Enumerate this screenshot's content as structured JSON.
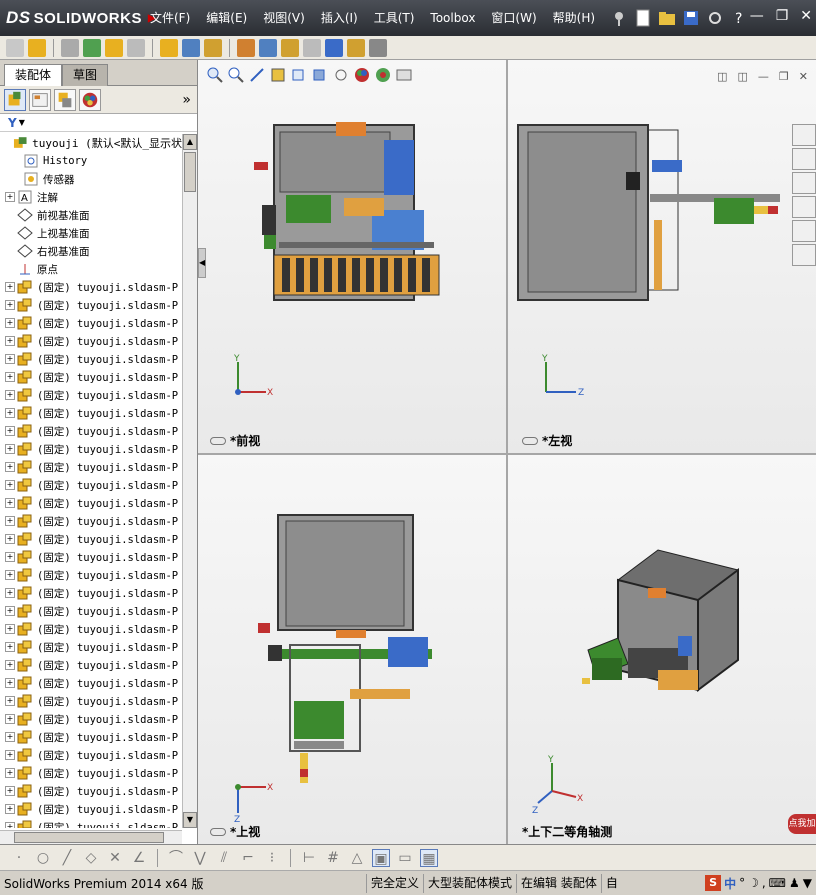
{
  "app": {
    "logo_prefix": "DS",
    "logo_text": "SOLIDWORKS"
  },
  "menu": [
    "文件(F)",
    "编辑(E)",
    "视图(V)",
    "插入(I)",
    "工具(T)",
    "Toolbox",
    "窗口(W)",
    "帮助(H)"
  ],
  "window_controls": {
    "minimize": "—",
    "restore": "❐",
    "close": "✕"
  },
  "left_panel": {
    "tabs": [
      "装配体",
      "草图"
    ],
    "more_label": "»",
    "filter_icon": "▼",
    "root": "tuyouji  (默认<默认_显示状",
    "folders": [
      {
        "label": "History",
        "icon": "history-icon"
      },
      {
        "label": "传感器",
        "icon": "sensor-icon"
      },
      {
        "label": "注解",
        "icon": "annotation-icon"
      },
      {
        "label": "前视基准面",
        "icon": "plane-icon"
      },
      {
        "label": "上视基准面",
        "icon": "plane-icon"
      },
      {
        "label": "右视基准面",
        "icon": "plane-icon"
      },
      {
        "label": "原点",
        "icon": "origin-icon"
      }
    ],
    "parts": [
      "(固定) tuyouji.sldasm-P",
      "(固定) tuyouji.sldasm-P",
      "(固定) tuyouji.sldasm-P",
      "(固定) tuyouji.sldasm-P",
      "(固定) tuyouji.sldasm-P",
      "(固定) tuyouji.sldasm-P",
      "(固定) tuyouji.sldasm-P",
      "(固定) tuyouji.sldasm-P",
      "(固定) tuyouji.sldasm-P",
      "(固定) tuyouji.sldasm-P",
      "(固定) tuyouji.sldasm-P",
      "(固定) tuyouji.sldasm-P",
      "(固定) tuyouji.sldasm-P",
      "(固定) tuyouji.sldasm-P",
      "(固定) tuyouji.sldasm-P",
      "(固定) tuyouji.sldasm-P",
      "(固定) tuyouji.sldasm-P",
      "(固定) tuyouji.sldasm-P",
      "(固定) tuyouji.sldasm-P",
      "(固定) tuyouji.sldasm-P",
      "(固定) tuyouji.sldasm-P",
      "(固定) tuyouji.sldasm-P",
      "(固定) tuyouji.sldasm-P",
      "(固定) tuyouji.sldasm-P",
      "(固定) tuyouji.sldasm-P",
      "(固定) tuyouji.sldasm-P",
      "(固定) tuyouji.sldasm-P",
      "(固定) tuyouji.sldasm-P",
      "(固定) tuyouji.sldasm-P",
      "(固定) tuyouji.sldasm-P",
      "(固定) tuyouji.sldasm-P",
      "(固定) tuyouji.sldasm-P",
      "(固定) tuyouji.sldasm-P"
    ]
  },
  "viewports": {
    "front": {
      "label": "*前视"
    },
    "left": {
      "label": "*左视"
    },
    "top": {
      "label": "*上视"
    },
    "iso": {
      "label": "*上下二等角轴测"
    }
  },
  "axes": {
    "x": "X",
    "y": "Y",
    "z": "Z"
  },
  "status": {
    "product": "SolidWorks Premium 2014 x64 版",
    "cells": [
      "完全定义",
      "大型装配体模式",
      "在编辑 装配体"
    ],
    "right_text": "自"
  },
  "ime": {
    "lang": "中",
    "badge": "点我加"
  },
  "colors": {
    "title_bg": "#2a2d33",
    "accent_red": "#cc0000",
    "part_icon": "#e8b020",
    "frame_green": "#3c8a2e"
  }
}
